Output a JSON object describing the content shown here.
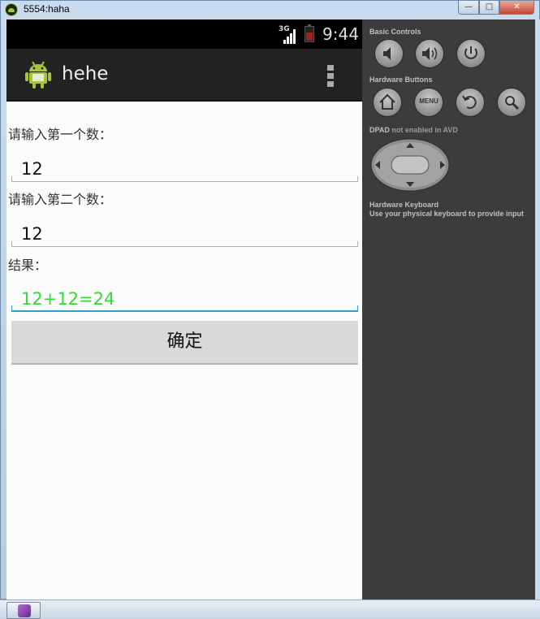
{
  "window": {
    "title": "5554:haha",
    "minimize_glyph": "—",
    "maximize_glyph": "□",
    "close_glyph": "✕"
  },
  "statusbar": {
    "network_type": "3G",
    "time": "9:44"
  },
  "actionbar": {
    "app_name": "hehe",
    "icon": "android-robot-icon",
    "overflow_icon": "overflow-menu-icon"
  },
  "form": {
    "first_label": "请输入第一个数：",
    "first_value": "12",
    "second_label": "请输入第二个数：",
    "second_value": "12",
    "result_label": "结果：",
    "result_value": "12+12=24",
    "confirm_label": "确定"
  },
  "panel": {
    "basic_controls": "Basic Controls",
    "hardware_buttons": "Hardware Buttons",
    "menu_button": "MENU",
    "dpad_title": "DPAD",
    "dpad_note": "not enabled in AVD",
    "keyboard_title": "Hardware Keyboard",
    "keyboard_note": "Use your physical keyboard to provide input"
  },
  "colors": {
    "result_text": "#33dd33",
    "focus_underline": "#33a2c4",
    "actionbar_bg": "#222222"
  }
}
